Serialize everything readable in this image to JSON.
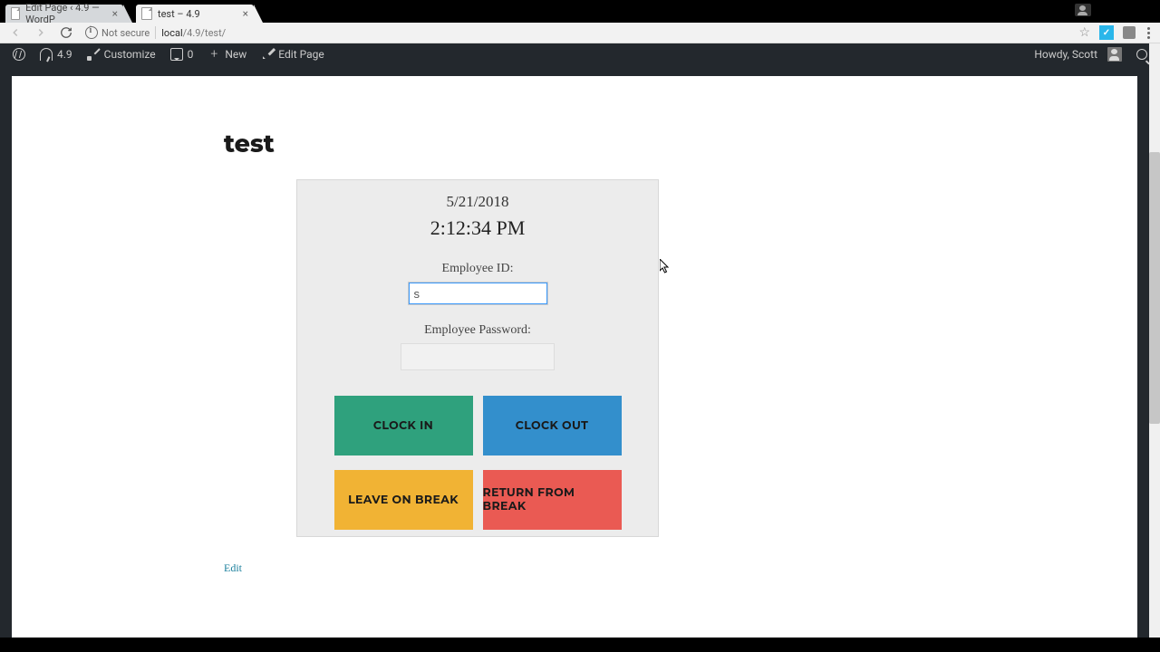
{
  "browser": {
    "tabs": [
      {
        "title": "Edit Page ‹ 4.9 — WordP",
        "active": false
      },
      {
        "title": "test – 4.9",
        "active": true
      }
    ],
    "not_secure": "Not secure",
    "url_host": "local",
    "url_path": "/4.9/test/"
  },
  "adminbar": {
    "site": "4.9",
    "customize": "Customize",
    "comments": "0",
    "new": "New",
    "edit_page": "Edit Page",
    "howdy": "Howdy, Scott"
  },
  "page": {
    "title": "test",
    "edit_link": "Edit"
  },
  "widget": {
    "date": "5/21/2018",
    "time": "2:12:34 PM",
    "id_label": "Employee ID:",
    "id_value": "s",
    "pw_label": "Employee Password:",
    "pw_value": "",
    "buttons": {
      "clock_in": "CLOCK IN",
      "clock_out": "CLOCK OUT",
      "leave": "LEAVE ON BREAK",
      "return": "RETURN FROM BREAK"
    }
  }
}
